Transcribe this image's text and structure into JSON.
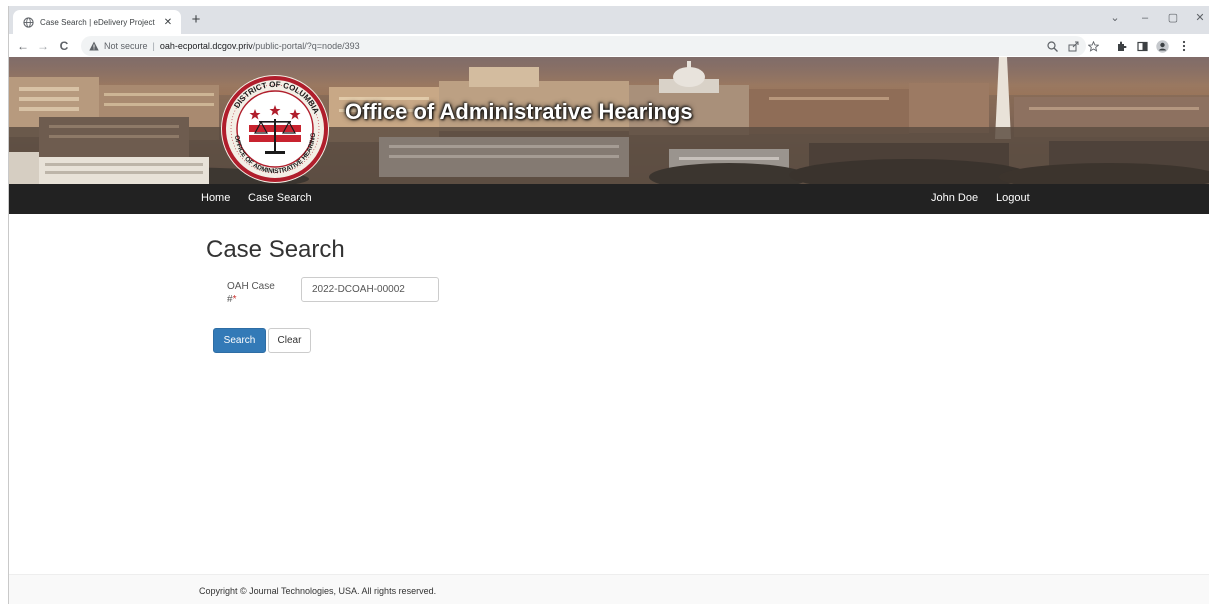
{
  "browser": {
    "tab_title": "Case Search | eDelivery Project",
    "tab_close": "✕",
    "new_tab": "+",
    "back": "←",
    "forward": "→",
    "reload": "C",
    "not_secure": "Not secure",
    "separator": "|",
    "url_host": "oah-ecportal.dcgov.priv",
    "url_path": "/public-portal/?q=node/393",
    "window_controls": {
      "dropdown": "⌄",
      "minimize": "–",
      "restore": "▢",
      "close": "✕"
    },
    "toolbar_icons": [
      "zoom-icon",
      "share-icon",
      "bookmark-star-icon",
      "extensions-icon",
      "side-panel-icon",
      "profile-icon",
      "menu-icon"
    ]
  },
  "banner": {
    "title": "Office of Administrative Hearings",
    "seal_text": "DISTRICT OF COLUMBIA · OFFICE OF ADMINISTRATIVE HEARINGS"
  },
  "nav": {
    "home": "Home",
    "case_search": "Case Search",
    "user": "John Doe",
    "logout": "Logout"
  },
  "page": {
    "title": "Case Search",
    "field_label": "OAH Case #",
    "required_mark": "*",
    "case_value": "2022-DCOAH-00002",
    "search_button": "Search",
    "clear_button": "Clear"
  },
  "footer": {
    "copyright": "Copyright © Journal Technologies, USA. All rights reserved."
  },
  "colors": {
    "navbar": "#222222",
    "primary_button": "#337ab7",
    "required": "#c9302c"
  }
}
